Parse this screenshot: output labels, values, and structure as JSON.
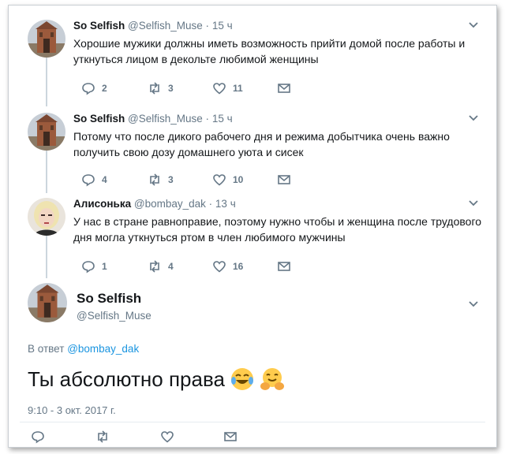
{
  "tweets": [
    {
      "name": "So Selfish",
      "handle": "@Selfish_Muse",
      "time": "15 ч",
      "text": "Хорошие мужики должны иметь возможность прийти домой после работы и уткнуться лицом в декольте любимой женщины",
      "replies": "2",
      "retweets": "3",
      "likes": "11",
      "avatar": "building-avatar"
    },
    {
      "name": "So Selfish",
      "handle": "@Selfish_Muse",
      "time": "15 ч",
      "text": "Потому что после дикого рабочего дня и режима добытчика очень важно получить свою дозу домашнего уюта и сисек",
      "replies": "4",
      "retweets": "3",
      "likes": "10",
      "avatar": "building-avatar"
    },
    {
      "name": "Алисонька",
      "handle": "@bombay_dak",
      "time": "13 ч",
      "text": "У нас в стране равноправие, поэтому нужно чтобы и женщина после трудового дня могла уткнуться ртом в член любимого мужчины",
      "replies": "1",
      "retweets": "4",
      "likes": "16",
      "avatar": "blonde-woman-avatar"
    }
  ],
  "main_tweet": {
    "name": "So Selfish",
    "handle": "@Selfish_Muse",
    "reply_prefix": "В ответ",
    "reply_to": "@bombay_dak",
    "text": "Ты абсолютно права",
    "emojis": [
      "face-with-tears-of-joy",
      "hugging-face"
    ],
    "timestamp": "9:10 - 3 окт. 2017 г."
  },
  "separator": "·",
  "colors": {
    "text": "#14171a",
    "muted": "#657786",
    "link": "#1b95e0",
    "thread_line": "#ccd6dd"
  }
}
